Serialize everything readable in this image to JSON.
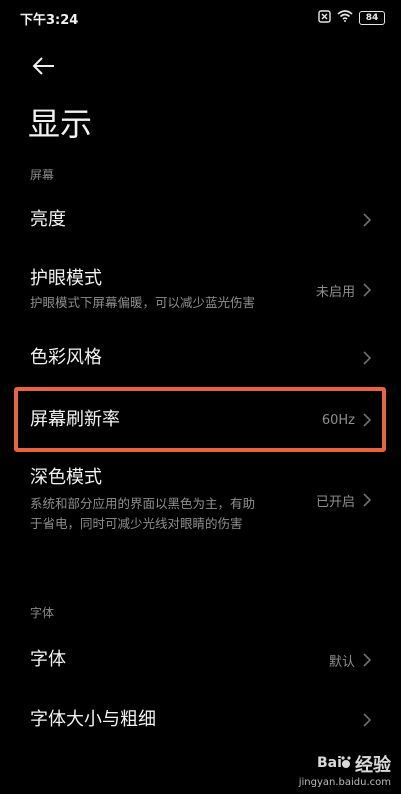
{
  "status": {
    "time": "下午3:24",
    "battery": "84"
  },
  "page": {
    "title": "显示"
  },
  "sections": {
    "screen": "屏幕",
    "font": "字体"
  },
  "items": [
    {
      "title": "亮度",
      "desc": "",
      "value": ""
    },
    {
      "title": "护眼模式",
      "desc": "护眼模式下屏幕偏暖，可以减少蓝光伤害",
      "value": "未启用"
    },
    {
      "title": "色彩风格",
      "desc": "",
      "value": ""
    },
    {
      "title": "屏幕刷新率",
      "desc": "",
      "value": "60Hz"
    },
    {
      "title": "深色模式",
      "desc_line1": "系统和部分应用的界面以黑色为主，有助",
      "desc_line2": "于省电，同时可减少光线对眼睛的伤害",
      "value": "已开启"
    },
    {
      "title": "字体",
      "desc": "",
      "value": "默认"
    },
    {
      "title": "字体大小与粗细",
      "desc": "",
      "value": ""
    }
  ],
  "watermark": {
    "brand": "经验",
    "url": "jingyan.baidu.com"
  },
  "colors": {
    "highlight": "#e8633f",
    "background": "#000000"
  }
}
